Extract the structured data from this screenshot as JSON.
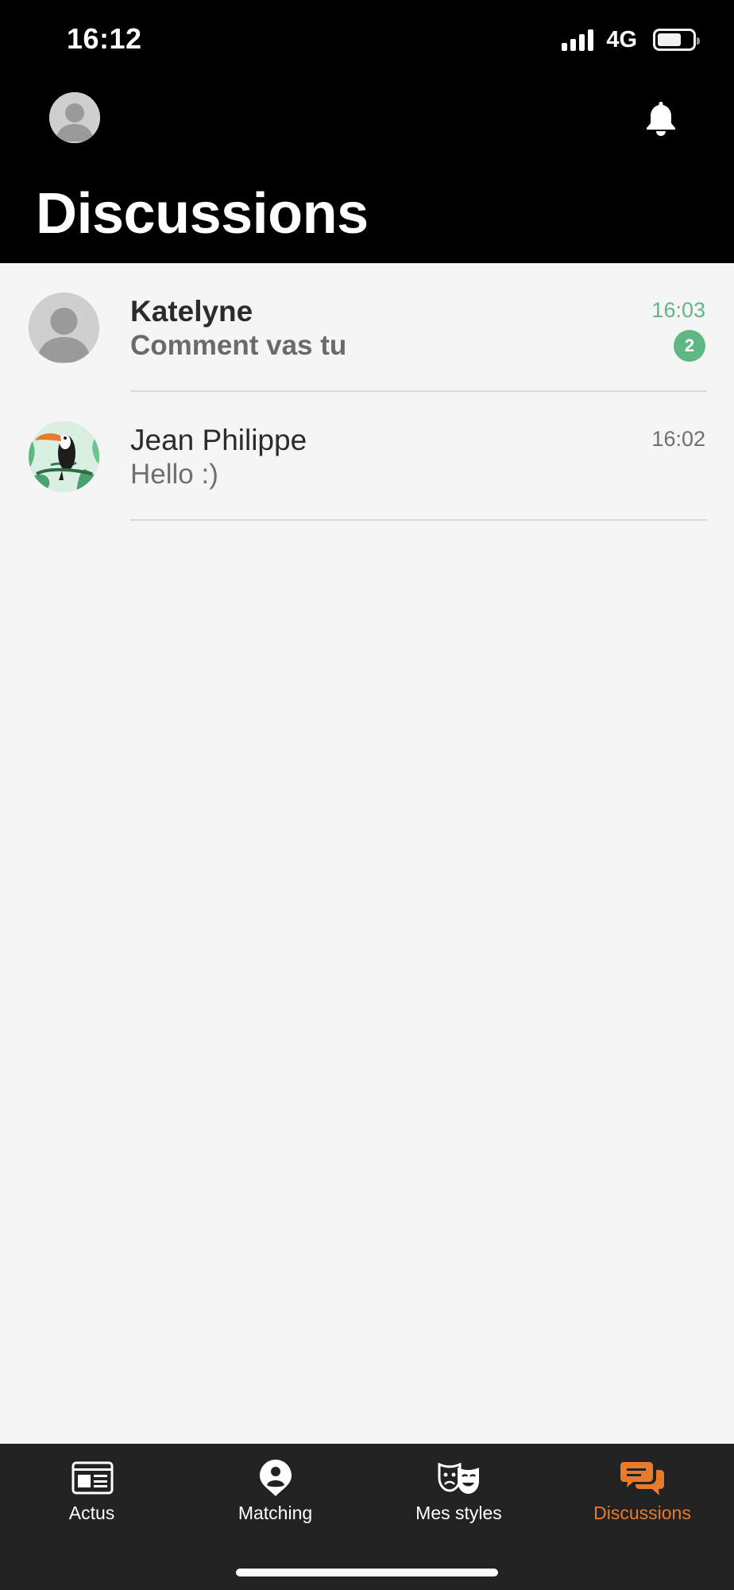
{
  "status_bar": {
    "time": "16:12",
    "network": "4G"
  },
  "header": {
    "title": "Discussions"
  },
  "conversations": [
    {
      "name": "Katelyne",
      "preview": "Comment vas tu",
      "time": "16:03",
      "unread_count": "2"
    },
    {
      "name": "Jean Philippe",
      "preview": "Hello :)",
      "time": "16:02"
    }
  ],
  "tabs": [
    {
      "label": "Actus",
      "icon": "newspaper-icon"
    },
    {
      "label": "Matching",
      "icon": "person-pin-icon"
    },
    {
      "label": "Mes styles",
      "icon": "theater-masks-icon"
    },
    {
      "label": "Discussions",
      "icon": "chat-bubbles-icon",
      "active": true
    }
  ],
  "colors": {
    "accent_orange": "#e87a2c",
    "unread_green": "#5fb883",
    "header_bg": "#000000",
    "tabbar_bg": "#222222"
  }
}
